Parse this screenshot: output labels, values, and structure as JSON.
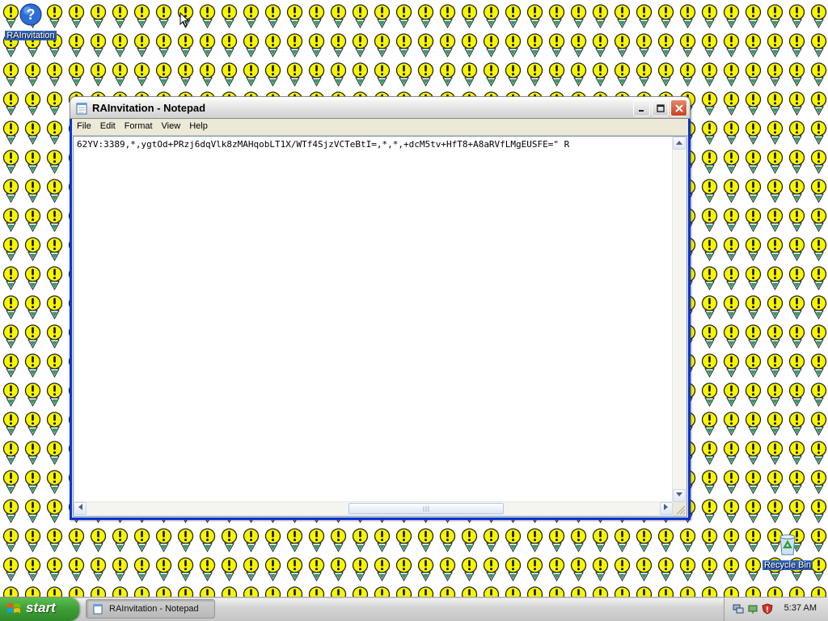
{
  "desktop": {
    "icons": [
      {
        "label": "RAInvitation",
        "icon": "remote-assistance-help-icon"
      },
      {
        "label": "Recycle Bin",
        "icon": "recycle-bin-icon"
      }
    ],
    "wallpaper_icon": "lightbulb-exclamation-icon"
  },
  "notepad": {
    "title": "RAInvitation - Notepad",
    "menu": [
      "File",
      "Edit",
      "Format",
      "View",
      "Help"
    ],
    "content": "62YV:3389,*,ygtOd+PRzj6dqVlk8zMAHqobLT1X/WTf4SjzVCTeBtI=,*,*,+dcM5tv+HfT8+A8aRVfLMgEUSFE=\" R",
    "buttons": {
      "minimize": "minimize",
      "maximize": "maximize",
      "close": "close"
    }
  },
  "taskbar": {
    "start_label": "start",
    "tasks": [
      {
        "label": "RAInvitation - Notepad",
        "icon": "notepad-icon"
      }
    ],
    "tray_icons": [
      "network-icon",
      "safely-remove-icon",
      "security-shield-icon"
    ],
    "clock": "5:37 AM"
  },
  "colors": {
    "title_bar": "#e2e2e2",
    "taskbar": "#d4d4d4",
    "start_button": "#3e9d36",
    "wallpaper_bulb": "#f6f600"
  }
}
